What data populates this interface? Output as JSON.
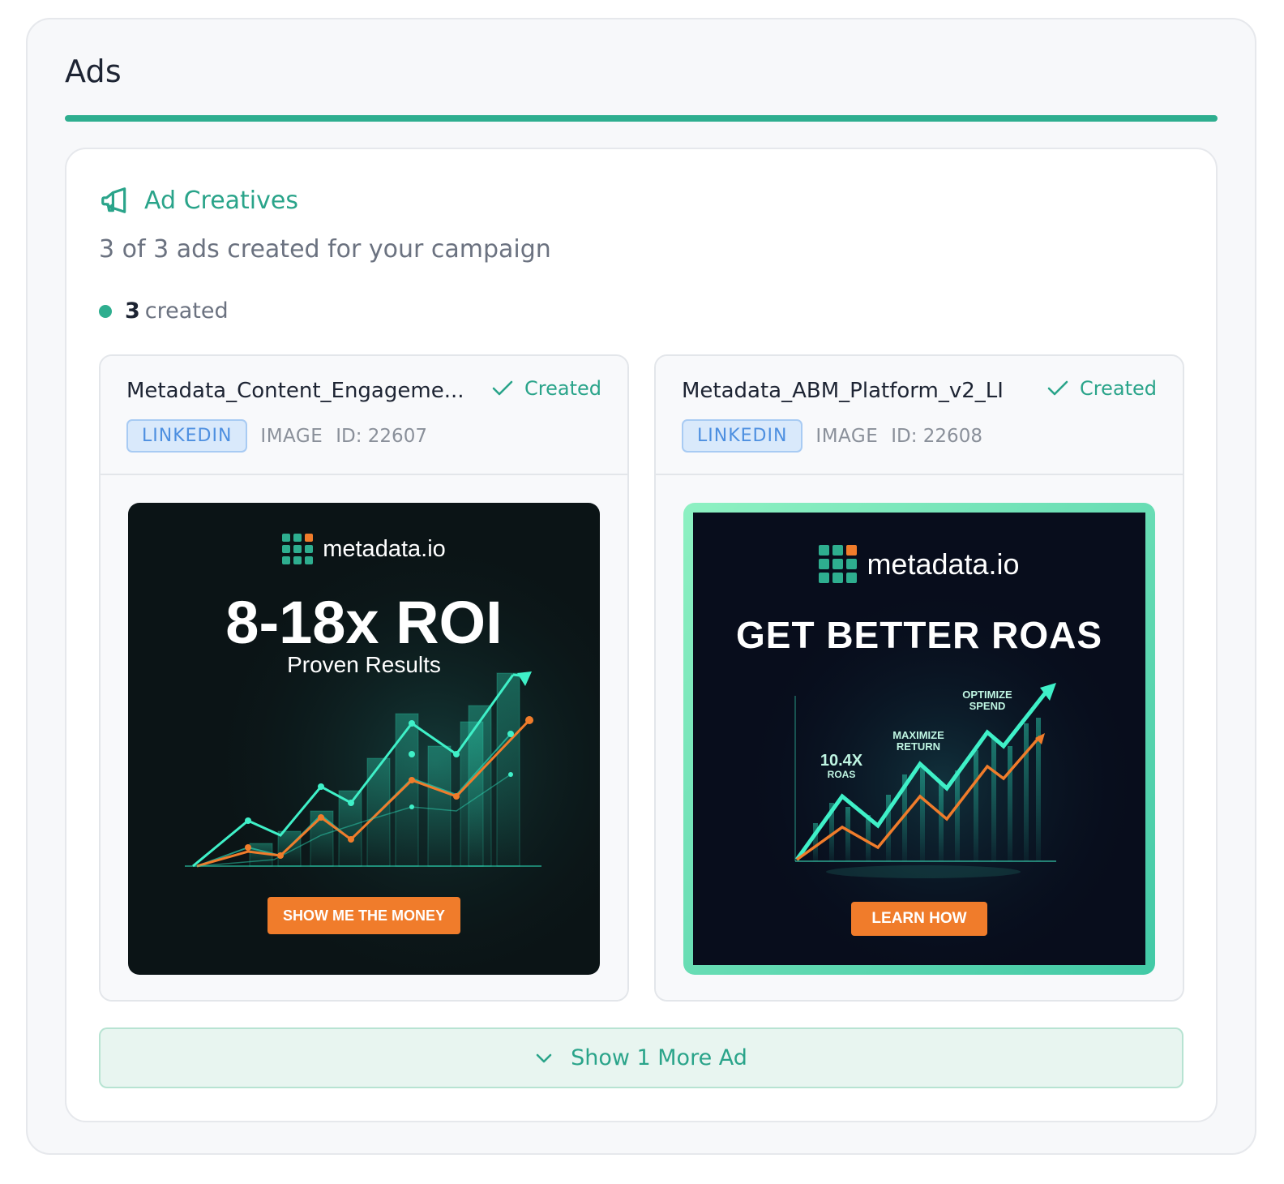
{
  "section": {
    "title": "Ads"
  },
  "panel": {
    "heading": "Ad Creatives",
    "heading_icon": "megaphone-icon",
    "subtitle": "3 of 3 ads created for your campaign",
    "summary": {
      "count": "3",
      "label": "created",
      "dot_color": "#2eae8f"
    }
  },
  "ads": [
    {
      "name": "Metadata_Content_Engageme...",
      "status": "Created",
      "status_icon": "check-icon",
      "platform": "LINKEDIN",
      "type": "IMAGE",
      "id_text": "ID: 22607",
      "creative": {
        "brand": "metadata.io",
        "headline": "8-18x ROI",
        "tagline": "Proven Results",
        "cta": "SHOW ME THE MONEY"
      }
    },
    {
      "name": "Metadata_ABM_Platform_v2_LI",
      "status": "Created",
      "status_icon": "check-icon",
      "platform": "LINKEDIN",
      "type": "IMAGE",
      "id_text": "ID: 22608",
      "creative": {
        "brand": "metadata.io",
        "headline": "GET BETTER ROAS",
        "labels": {
          "roas_value": "10.4X",
          "roas_caption": "ROAS",
          "maximize_1": "MAXIMIZE",
          "maximize_2": "RETURN",
          "optimize_1": "OPTIMIZE",
          "optimize_2": "SPEND"
        },
        "cta": "LEARN HOW"
      }
    }
  ],
  "show_more": {
    "label": "Show 1 More Ad",
    "icon": "chevron-down-icon"
  },
  "colors": {
    "accent": "#2eae8f",
    "platform_badge": "#4d8fe0",
    "cta": "#f07c2b"
  }
}
